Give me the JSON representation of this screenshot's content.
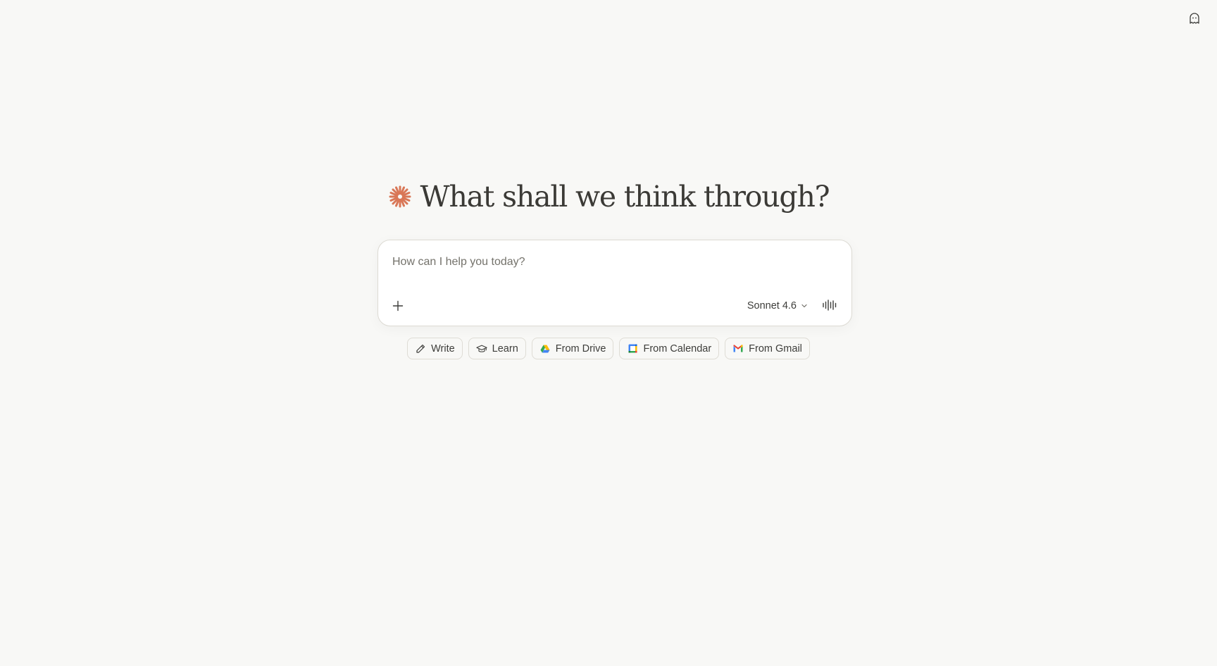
{
  "header": {
    "top_right_icon": "ghost-icon"
  },
  "greeting": {
    "logo_icon": "spark-icon",
    "logo_color": "#d97757",
    "title": "What shall we think through?"
  },
  "composer": {
    "placeholder": "How can I help you today?",
    "value": "",
    "add_icon": "plus-icon",
    "model_label": "Sonnet 4.6",
    "model_dropdown_icon": "chevron-down-icon",
    "voice_icon": "waveform-icon"
  },
  "chips": [
    {
      "label": "Write",
      "icon": "pencil-icon"
    },
    {
      "label": "Learn",
      "icon": "graduation-cap-icon"
    },
    {
      "label": "From Drive",
      "icon": "google-drive-icon"
    },
    {
      "label": "From Calendar",
      "icon": "google-calendar-icon"
    },
    {
      "label": "From Gmail",
      "icon": "gmail-icon"
    }
  ]
}
